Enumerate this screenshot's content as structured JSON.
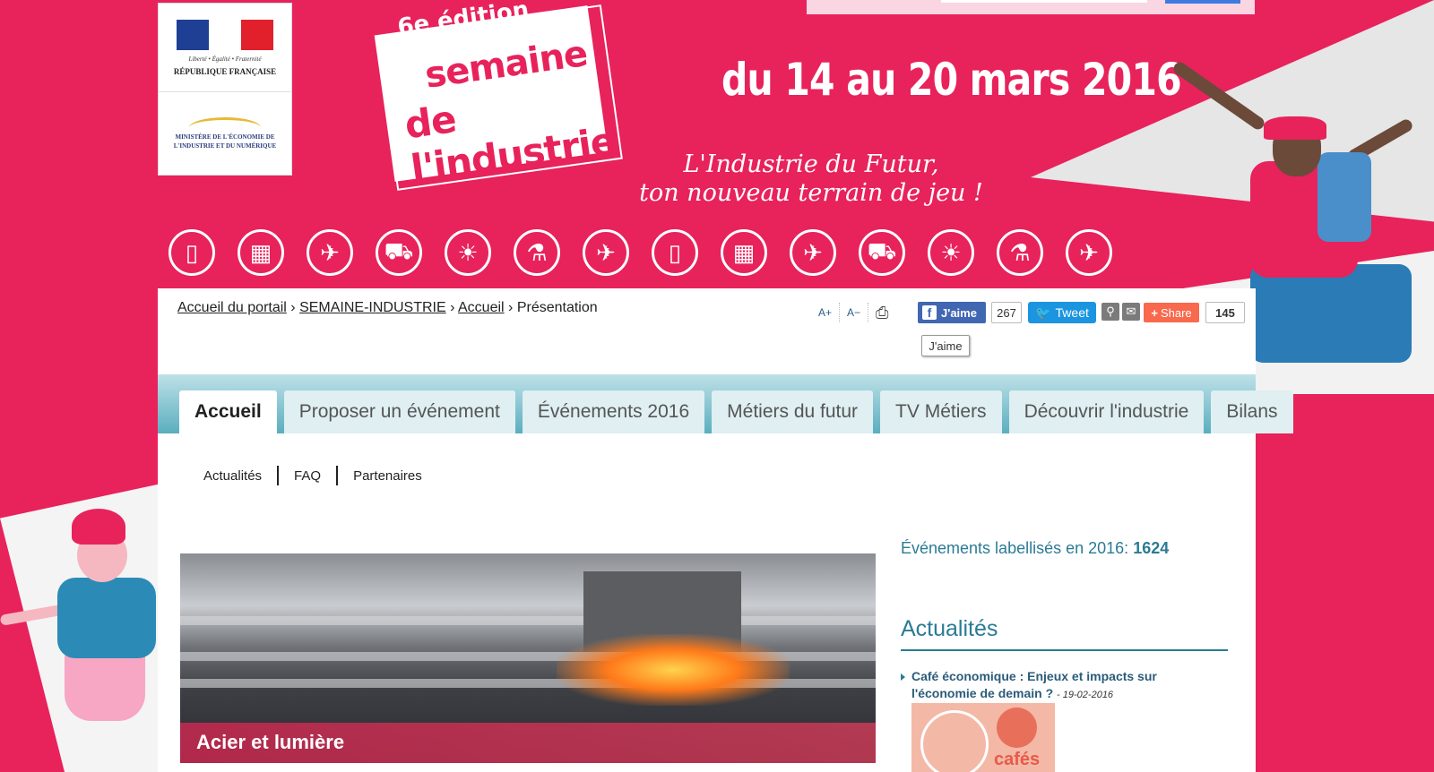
{
  "header": {
    "rf_motto": "Liberté • Égalité • Fraternité",
    "rf_name": "RÉPUBLIQUE FRANÇAISE",
    "ministry": "MINISTÈRE DE L'ÉCONOMIE DE L'INDUSTRIE ET DU NUMÉRIQUE",
    "edition": "6e édition",
    "event_line1": "semaine",
    "event_line2": "de l'industrie",
    "dates": "du 14 au 20 mars 2016",
    "slogan_line1": "L'Industrie du Futur,",
    "slogan_line2": "ton nouveau terrain de jeu !",
    "sector_icons": [
      "mobile-icon",
      "factory-icon",
      "drone-icon",
      "truck-icon",
      "wind-solar-icon",
      "chemistry-icon",
      "plane-icon",
      "mobile-icon",
      "factory-icon",
      "drone-icon",
      "truck-icon",
      "wind-solar-icon",
      "chemistry-icon",
      "plane-icon"
    ]
  },
  "breadcrumb": {
    "items": [
      "Accueil du portail",
      "SEMAINE-INDUSTRIE",
      "Accueil"
    ],
    "current": "Présentation",
    "separator": "›"
  },
  "toolbar": {
    "font_increase": "A+",
    "font_decrease": "A−",
    "print_icon": "print-icon"
  },
  "social": {
    "facebook_label": "J'aime",
    "facebook_count": "267",
    "tweet_label": "Tweet",
    "share_label": "Share",
    "share_count": "145",
    "tooltip": "J'aime"
  },
  "tabs": [
    {
      "label": "Accueil",
      "active": true
    },
    {
      "label": "Proposer un événement"
    },
    {
      "label": "Événements 2016"
    },
    {
      "label": "Métiers du futur"
    },
    {
      "label": "TV Métiers"
    },
    {
      "label": "Découvrir l'industrie"
    },
    {
      "label": "Bilans"
    }
  ],
  "subnav": [
    "Actualités",
    "FAQ",
    "Partenaires"
  ],
  "hero": {
    "caption": "Acier et lumière"
  },
  "stats": {
    "label": "Événements labellisés en 2016:",
    "value": "1624"
  },
  "news": {
    "title": "Actualités",
    "items": [
      {
        "title": "Café économique : Enjeux et impacts sur l'économie de demain ?",
        "date": "19-02-2016",
        "thumb_text": "cafés"
      }
    ]
  },
  "colors": {
    "brand_pink": "#e8225b",
    "teal": "#2b7b95",
    "facebook": "#4267b2",
    "twitter": "#1b95e0",
    "share": "#f8694d"
  }
}
